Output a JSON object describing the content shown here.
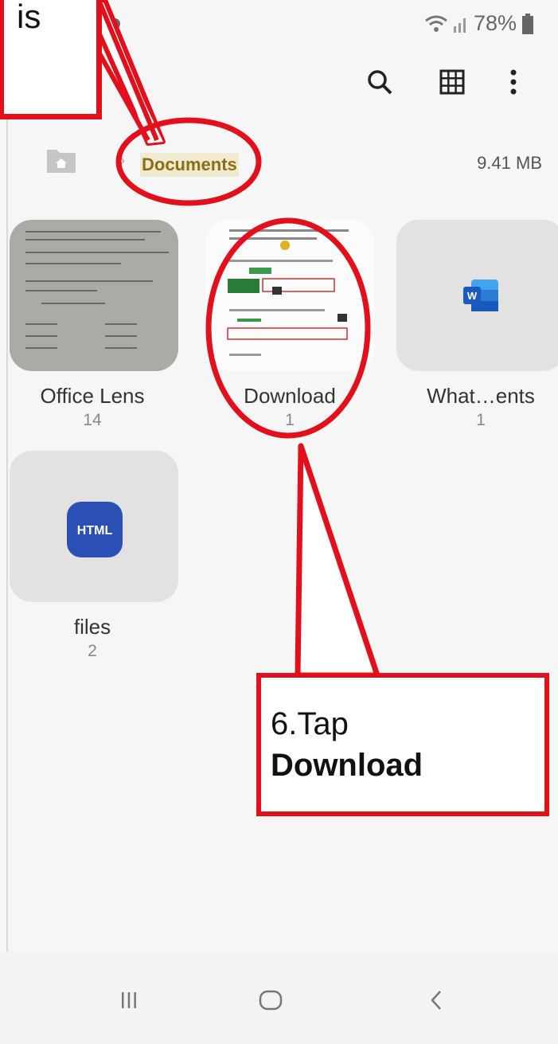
{
  "status_bar": {
    "battery": "78%"
  },
  "toolbar": {
    "search_icon": "search-icon",
    "grid_icon": "grid-view-icon",
    "more_icon": "more-vert-icon"
  },
  "path": {
    "folder": "Documents",
    "size": "9.41 MB"
  },
  "folders": [
    {
      "name": "Office Lens",
      "count": "14"
    },
    {
      "name": "Download",
      "count": "1"
    },
    {
      "name": "What…ents",
      "count": "1"
    },
    {
      "name": "files",
      "count": "2"
    }
  ],
  "badges": {
    "word": "W",
    "html": "HTML"
  },
  "callouts": {
    "top_partial": "is",
    "main_line1": "6.Tap",
    "main_line2": "Download"
  },
  "colors": {
    "annotation_red": "#e3101c",
    "html_badge": "#2b4fb4",
    "word_blue": "#185abd"
  }
}
